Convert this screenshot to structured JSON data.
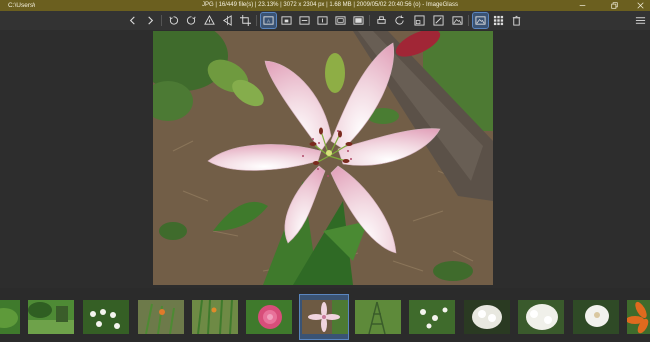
{
  "titlebar": {
    "path": "C:\\Users\\",
    "path_chevron": "›",
    "info": "JPG  |  16/449 file(s)  |  23.13%  |  3072 x 2304 px  |  1.68 MB  |  2009/05/02 20:40:56 (o)  - ImageGlass",
    "bg_color": "#6b5f1f"
  },
  "window_controls": [
    "minimize-icon",
    "restore-icon",
    "close-icon"
  ],
  "toolbar": {
    "buttons": [
      "previous-image",
      "next-image",
      "rotate-left",
      "rotate-right",
      "flip-vertical",
      "flip-horizontal",
      "crop",
      "auto-zoom",
      "lock-zoom",
      "scale-width",
      "scale-height",
      "scale-to-fit",
      "scale-to-fill",
      "open-with",
      "refresh",
      "adjust-window",
      "color-picker",
      "slideshow",
      "thumbnail-bar",
      "gallery-grid",
      "delete",
      "main-menu"
    ],
    "active": [
      "auto-zoom",
      "thumbnail-bar"
    ],
    "accent_color": "#5a86c0"
  },
  "viewer": {
    "image_name": "pink-lily-flower"
  },
  "thumbnails": {
    "count_visible": 13,
    "selected_index": 6,
    "items": [
      "green-leaves",
      "garden-bench",
      "white-flowers-shrub",
      "orange-lily-plants",
      "tall-grass-flowers",
      "pink-dahlia",
      "pink-lily",
      "trellis-plant",
      "white-daisies-green",
      "white-hydrangea",
      "white-flowers-cluster",
      "white-rhododendron",
      "orange-lily"
    ]
  }
}
